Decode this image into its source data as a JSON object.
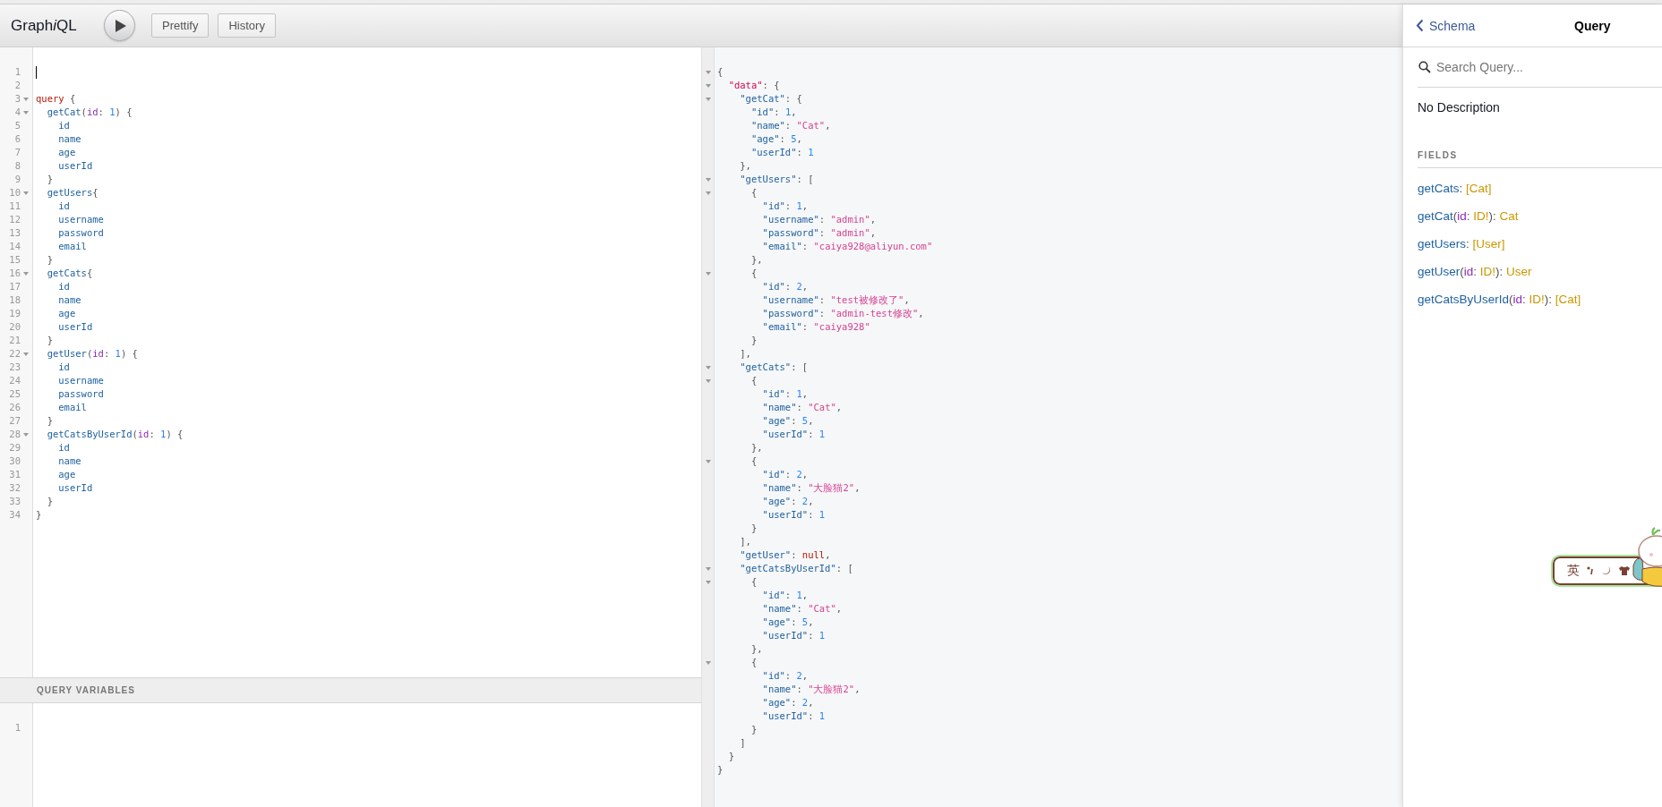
{
  "toolbar": {
    "title": [
      {
        "text": "Graph",
        "italic": false
      },
      {
        "text": "i",
        "italic": true
      },
      {
        "text": "QL",
        "italic": false
      }
    ],
    "buttons": [
      "Prettify",
      "History"
    ]
  },
  "query_editor": {
    "lines": [
      {
        "number": "1",
        "fold": false,
        "cursor": true
      },
      {
        "number": "2",
        "fold": false,
        "cursor": false
      },
      {
        "number": "3",
        "fold": true,
        "cursor": false,
        "tokens": [
          {
            "kind": "keyword",
            "text": "query"
          },
          {
            "kind": "punct",
            "text": " {"
          }
        ]
      },
      {
        "number": "4",
        "fold": true,
        "cursor": false,
        "tokens": [
          {
            "kind": "def",
            "text": "  getCat"
          },
          {
            "kind": "punct",
            "text": "("
          },
          {
            "kind": "attr",
            "text": "id"
          },
          {
            "kind": "punct",
            "text": ": "
          },
          {
            "kind": "number",
            "text": "1"
          },
          {
            "kind": "punct",
            "text": ") {"
          }
        ]
      },
      {
        "number": "5",
        "fold": false,
        "cursor": false,
        "tokens": [
          {
            "kind": "def",
            "text": "    id"
          }
        ]
      },
      {
        "number": "6",
        "fold": false,
        "cursor": false,
        "tokens": [
          {
            "kind": "def",
            "text": "    name"
          }
        ]
      },
      {
        "number": "7",
        "fold": false,
        "cursor": false,
        "tokens": [
          {
            "kind": "def",
            "text": "    age"
          }
        ]
      },
      {
        "number": "8",
        "fold": false,
        "cursor": false,
        "tokens": [
          {
            "kind": "def",
            "text": "    userId"
          }
        ]
      },
      {
        "number": "9",
        "fold": false,
        "cursor": false,
        "tokens": [
          {
            "kind": "punct",
            "text": "  }"
          }
        ]
      },
      {
        "number": "10",
        "fold": true,
        "cursor": false,
        "tokens": [
          {
            "kind": "def",
            "text": "  getUsers"
          },
          {
            "kind": "punct",
            "text": "{"
          }
        ]
      },
      {
        "number": "11",
        "fold": false,
        "cursor": false,
        "tokens": [
          {
            "kind": "def",
            "text": "    id"
          }
        ]
      },
      {
        "number": "12",
        "fold": false,
        "cursor": false,
        "tokens": [
          {
            "kind": "def",
            "text": "    username"
          }
        ]
      },
      {
        "number": "13",
        "fold": false,
        "cursor": false,
        "tokens": [
          {
            "kind": "def",
            "text": "    password"
          }
        ]
      },
      {
        "number": "14",
        "fold": false,
        "cursor": false,
        "tokens": [
          {
            "kind": "def",
            "text": "    email"
          }
        ]
      },
      {
        "number": "15",
        "fold": false,
        "cursor": false,
        "tokens": [
          {
            "kind": "punct",
            "text": "  }"
          }
        ]
      },
      {
        "number": "16",
        "fold": true,
        "cursor": false,
        "tokens": [
          {
            "kind": "def",
            "text": "  getCats"
          },
          {
            "kind": "punct",
            "text": "{"
          }
        ]
      },
      {
        "number": "17",
        "fold": false,
        "cursor": false,
        "tokens": [
          {
            "kind": "def",
            "text": "    id"
          }
        ]
      },
      {
        "number": "18",
        "fold": false,
        "cursor": false,
        "tokens": [
          {
            "kind": "def",
            "text": "    name"
          }
        ]
      },
      {
        "number": "19",
        "fold": false,
        "cursor": false,
        "tokens": [
          {
            "kind": "def",
            "text": "    age"
          }
        ]
      },
      {
        "number": "20",
        "fold": false,
        "cursor": false,
        "tokens": [
          {
            "kind": "def",
            "text": "    userId"
          }
        ]
      },
      {
        "number": "21",
        "fold": false,
        "cursor": false,
        "tokens": [
          {
            "kind": "punct",
            "text": "  }"
          }
        ]
      },
      {
        "number": "22",
        "fold": true,
        "cursor": false,
        "tokens": [
          {
            "kind": "def",
            "text": "  getUser"
          },
          {
            "kind": "punct",
            "text": "("
          },
          {
            "kind": "attr",
            "text": "id"
          },
          {
            "kind": "punct",
            "text": ": "
          },
          {
            "kind": "number",
            "text": "1"
          },
          {
            "kind": "punct",
            "text": ") {"
          }
        ]
      },
      {
        "number": "23",
        "fold": false,
        "cursor": false,
        "tokens": [
          {
            "kind": "def",
            "text": "    id"
          }
        ]
      },
      {
        "number": "24",
        "fold": false,
        "cursor": false,
        "tokens": [
          {
            "kind": "def",
            "text": "    username"
          }
        ]
      },
      {
        "number": "25",
        "fold": false,
        "cursor": false,
        "tokens": [
          {
            "kind": "def",
            "text": "    password"
          }
        ]
      },
      {
        "number": "26",
        "fold": false,
        "cursor": false,
        "tokens": [
          {
            "kind": "def",
            "text": "    email"
          }
        ]
      },
      {
        "number": "27",
        "fold": false,
        "cursor": false,
        "tokens": [
          {
            "kind": "punct",
            "text": "  }"
          }
        ]
      },
      {
        "number": "28",
        "fold": true,
        "cursor": false,
        "tokens": [
          {
            "kind": "def",
            "text": "  getCatsByUserId"
          },
          {
            "kind": "punct",
            "text": "("
          },
          {
            "kind": "attr",
            "text": "id"
          },
          {
            "kind": "punct",
            "text": ": "
          },
          {
            "kind": "number",
            "text": "1"
          },
          {
            "kind": "punct",
            "text": ") {"
          }
        ]
      },
      {
        "number": "29",
        "fold": false,
        "cursor": false,
        "tokens": [
          {
            "kind": "def",
            "text": "    id"
          }
        ]
      },
      {
        "number": "30",
        "fold": false,
        "cursor": false,
        "tokens": [
          {
            "kind": "def",
            "text": "    name"
          }
        ]
      },
      {
        "number": "31",
        "fold": false,
        "cursor": false,
        "tokens": [
          {
            "kind": "def",
            "text": "    age"
          }
        ]
      },
      {
        "number": "32",
        "fold": false,
        "cursor": false,
        "tokens": [
          {
            "kind": "def",
            "text": "    userId"
          }
        ]
      },
      {
        "number": "33",
        "fold": false,
        "cursor": false,
        "tokens": [
          {
            "kind": "punct",
            "text": "  }"
          }
        ]
      },
      {
        "number": "34",
        "fold": false,
        "cursor": false,
        "tokens": [
          {
            "kind": "punct",
            "text": "}"
          }
        ]
      }
    ]
  },
  "variables": {
    "title": "QUERY VARIABLES",
    "lines": [
      {
        "number": "1"
      }
    ]
  },
  "result": {
    "lines": [
      {
        "fold": true,
        "tokens": [
          {
            "kind": "punct",
            "text": "{"
          }
        ]
      },
      {
        "fold": true,
        "tokens": [
          {
            "kind": "datakey",
            "text": "  \"data\""
          },
          {
            "kind": "punct",
            "text": ": {"
          }
        ]
      },
      {
        "fold": true,
        "tokens": [
          {
            "kind": "key",
            "text": "    \"getCat\""
          },
          {
            "kind": "punct",
            "text": ": {"
          }
        ]
      },
      {
        "fold": false,
        "tokens": [
          {
            "kind": "key",
            "text": "      \"id\""
          },
          {
            "kind": "punct",
            "text": ": "
          },
          {
            "kind": "number",
            "text": "1"
          },
          {
            "kind": "punct",
            "text": ","
          }
        ]
      },
      {
        "fold": false,
        "tokens": [
          {
            "kind": "key",
            "text": "      \"name\""
          },
          {
            "kind": "punct",
            "text": ": "
          },
          {
            "kind": "string",
            "text": "\"Cat\""
          },
          {
            "kind": "punct",
            "text": ","
          }
        ]
      },
      {
        "fold": false,
        "tokens": [
          {
            "kind": "key",
            "text": "      \"age\""
          },
          {
            "kind": "punct",
            "text": ": "
          },
          {
            "kind": "number",
            "text": "5"
          },
          {
            "kind": "punct",
            "text": ","
          }
        ]
      },
      {
        "fold": false,
        "tokens": [
          {
            "kind": "key",
            "text": "      \"userId\""
          },
          {
            "kind": "punct",
            "text": ": "
          },
          {
            "kind": "number",
            "text": "1"
          }
        ]
      },
      {
        "fold": false,
        "tokens": [
          {
            "kind": "punct",
            "text": "    },"
          }
        ]
      },
      {
        "fold": true,
        "tokens": [
          {
            "kind": "key",
            "text": "    \"getUsers\""
          },
          {
            "kind": "punct",
            "text": ": ["
          }
        ]
      },
      {
        "fold": true,
        "tokens": [
          {
            "kind": "punct",
            "text": "      {"
          }
        ]
      },
      {
        "fold": false,
        "tokens": [
          {
            "kind": "key",
            "text": "        \"id\""
          },
          {
            "kind": "punct",
            "text": ": "
          },
          {
            "kind": "number",
            "text": "1"
          },
          {
            "kind": "punct",
            "text": ","
          }
        ]
      },
      {
        "fold": false,
        "tokens": [
          {
            "kind": "key",
            "text": "        \"username\""
          },
          {
            "kind": "punct",
            "text": ": "
          },
          {
            "kind": "string",
            "text": "\"admin\""
          },
          {
            "kind": "punct",
            "text": ","
          }
        ]
      },
      {
        "fold": false,
        "tokens": [
          {
            "kind": "key",
            "text": "        \"password\""
          },
          {
            "kind": "punct",
            "text": ": "
          },
          {
            "kind": "string",
            "text": "\"admin\""
          },
          {
            "kind": "punct",
            "text": ","
          }
        ]
      },
      {
        "fold": false,
        "tokens": [
          {
            "kind": "key",
            "text": "        \"email\""
          },
          {
            "kind": "punct",
            "text": ": "
          },
          {
            "kind": "string",
            "text": "\"caiya928@aliyun.com\""
          }
        ]
      },
      {
        "fold": false,
        "tokens": [
          {
            "kind": "punct",
            "text": "      },"
          }
        ]
      },
      {
        "fold": true,
        "tokens": [
          {
            "kind": "punct",
            "text": "      {"
          }
        ]
      },
      {
        "fold": false,
        "tokens": [
          {
            "kind": "key",
            "text": "        \"id\""
          },
          {
            "kind": "punct",
            "text": ": "
          },
          {
            "kind": "number",
            "text": "2"
          },
          {
            "kind": "punct",
            "text": ","
          }
        ]
      },
      {
        "fold": false,
        "tokens": [
          {
            "kind": "key",
            "text": "        \"username\""
          },
          {
            "kind": "punct",
            "text": ": "
          },
          {
            "kind": "string",
            "text": "\"test被修改了\""
          },
          {
            "kind": "punct",
            "text": ","
          }
        ]
      },
      {
        "fold": false,
        "tokens": [
          {
            "kind": "key",
            "text": "        \"password\""
          },
          {
            "kind": "punct",
            "text": ": "
          },
          {
            "kind": "string",
            "text": "\"admin-test修改\""
          },
          {
            "kind": "punct",
            "text": ","
          }
        ]
      },
      {
        "fold": false,
        "tokens": [
          {
            "kind": "key",
            "text": "        \"email\""
          },
          {
            "kind": "punct",
            "text": ": "
          },
          {
            "kind": "string",
            "text": "\"caiya928\""
          }
        ]
      },
      {
        "fold": false,
        "tokens": [
          {
            "kind": "punct",
            "text": "      }"
          }
        ]
      },
      {
        "fold": false,
        "tokens": [
          {
            "kind": "punct",
            "text": "    ],"
          }
        ]
      },
      {
        "fold": true,
        "tokens": [
          {
            "kind": "key",
            "text": "    \"getCats\""
          },
          {
            "kind": "punct",
            "text": ": ["
          }
        ]
      },
      {
        "fold": true,
        "tokens": [
          {
            "kind": "punct",
            "text": "      {"
          }
        ]
      },
      {
        "fold": false,
        "tokens": [
          {
            "kind": "key",
            "text": "        \"id\""
          },
          {
            "kind": "punct",
            "text": ": "
          },
          {
            "kind": "number",
            "text": "1"
          },
          {
            "kind": "punct",
            "text": ","
          }
        ]
      },
      {
        "fold": false,
        "tokens": [
          {
            "kind": "key",
            "text": "        \"name\""
          },
          {
            "kind": "punct",
            "text": ": "
          },
          {
            "kind": "string",
            "text": "\"Cat\""
          },
          {
            "kind": "punct",
            "text": ","
          }
        ]
      },
      {
        "fold": false,
        "tokens": [
          {
            "kind": "key",
            "text": "        \"age\""
          },
          {
            "kind": "punct",
            "text": ": "
          },
          {
            "kind": "number",
            "text": "5"
          },
          {
            "kind": "punct",
            "text": ","
          }
        ]
      },
      {
        "fold": false,
        "tokens": [
          {
            "kind": "key",
            "text": "        \"userId\""
          },
          {
            "kind": "punct",
            "text": ": "
          },
          {
            "kind": "number",
            "text": "1"
          }
        ]
      },
      {
        "fold": false,
        "tokens": [
          {
            "kind": "punct",
            "text": "      },"
          }
        ]
      },
      {
        "fold": true,
        "tokens": [
          {
            "kind": "punct",
            "text": "      {"
          }
        ]
      },
      {
        "fold": false,
        "tokens": [
          {
            "kind": "key",
            "text": "        \"id\""
          },
          {
            "kind": "punct",
            "text": ": "
          },
          {
            "kind": "number",
            "text": "2"
          },
          {
            "kind": "punct",
            "text": ","
          }
        ]
      },
      {
        "fold": false,
        "tokens": [
          {
            "kind": "key",
            "text": "        \"name\""
          },
          {
            "kind": "punct",
            "text": ": "
          },
          {
            "kind": "string",
            "text": "\"大脸猫2\""
          },
          {
            "kind": "punct",
            "text": ","
          }
        ]
      },
      {
        "fold": false,
        "tokens": [
          {
            "kind": "key",
            "text": "        \"age\""
          },
          {
            "kind": "punct",
            "text": ": "
          },
          {
            "kind": "number",
            "text": "2"
          },
          {
            "kind": "punct",
            "text": ","
          }
        ]
      },
      {
        "fold": false,
        "tokens": [
          {
            "kind": "key",
            "text": "        \"userId\""
          },
          {
            "kind": "punct",
            "text": ": "
          },
          {
            "kind": "number",
            "text": "1"
          }
        ]
      },
      {
        "fold": false,
        "tokens": [
          {
            "kind": "punct",
            "text": "      }"
          }
        ]
      },
      {
        "fold": false,
        "tokens": [
          {
            "kind": "punct",
            "text": "    ],"
          }
        ]
      },
      {
        "fold": false,
        "tokens": [
          {
            "kind": "key",
            "text": "    \"getUser\""
          },
          {
            "kind": "punct",
            "text": ": "
          },
          {
            "kind": "null",
            "text": "null"
          },
          {
            "kind": "punct",
            "text": ","
          }
        ]
      },
      {
        "fold": true,
        "tokens": [
          {
            "kind": "key",
            "text": "    \"getCatsByUserId\""
          },
          {
            "kind": "punct",
            "text": ": ["
          }
        ]
      },
      {
        "fold": true,
        "tokens": [
          {
            "kind": "punct",
            "text": "      {"
          }
        ]
      },
      {
        "fold": false,
        "tokens": [
          {
            "kind": "key",
            "text": "        \"id\""
          },
          {
            "kind": "punct",
            "text": ": "
          },
          {
            "kind": "number",
            "text": "1"
          },
          {
            "kind": "punct",
            "text": ","
          }
        ]
      },
      {
        "fold": false,
        "tokens": [
          {
            "kind": "key",
            "text": "        \"name\""
          },
          {
            "kind": "punct",
            "text": ": "
          },
          {
            "kind": "string",
            "text": "\"Cat\""
          },
          {
            "kind": "punct",
            "text": ","
          }
        ]
      },
      {
        "fold": false,
        "tokens": [
          {
            "kind": "key",
            "text": "        \"age\""
          },
          {
            "kind": "punct",
            "text": ": "
          },
          {
            "kind": "number",
            "text": "5"
          },
          {
            "kind": "punct",
            "text": ","
          }
        ]
      },
      {
        "fold": false,
        "tokens": [
          {
            "kind": "key",
            "text": "        \"userId\""
          },
          {
            "kind": "punct",
            "text": ": "
          },
          {
            "kind": "number",
            "text": "1"
          }
        ]
      },
      {
        "fold": false,
        "tokens": [
          {
            "kind": "punct",
            "text": "      },"
          }
        ]
      },
      {
        "fold": true,
        "tokens": [
          {
            "kind": "punct",
            "text": "      {"
          }
        ]
      },
      {
        "fold": false,
        "tokens": [
          {
            "kind": "key",
            "text": "        \"id\""
          },
          {
            "kind": "punct",
            "text": ": "
          },
          {
            "kind": "number",
            "text": "2"
          },
          {
            "kind": "punct",
            "text": ","
          }
        ]
      },
      {
        "fold": false,
        "tokens": [
          {
            "kind": "key",
            "text": "        \"name\""
          },
          {
            "kind": "punct",
            "text": ": "
          },
          {
            "kind": "string",
            "text": "\"大脸猫2\""
          },
          {
            "kind": "punct",
            "text": ","
          }
        ]
      },
      {
        "fold": false,
        "tokens": [
          {
            "kind": "key",
            "text": "        \"age\""
          },
          {
            "kind": "punct",
            "text": ": "
          },
          {
            "kind": "number",
            "text": "2"
          },
          {
            "kind": "punct",
            "text": ","
          }
        ]
      },
      {
        "fold": false,
        "tokens": [
          {
            "kind": "key",
            "text": "        \"userId\""
          },
          {
            "kind": "punct",
            "text": ": "
          },
          {
            "kind": "number",
            "text": "1"
          }
        ]
      },
      {
        "fold": false,
        "tokens": [
          {
            "kind": "punct",
            "text": "      }"
          }
        ]
      },
      {
        "fold": false,
        "tokens": [
          {
            "kind": "punct",
            "text": "    ]"
          }
        ]
      },
      {
        "fold": false,
        "tokens": [
          {
            "kind": "punct",
            "text": "  }"
          }
        ]
      },
      {
        "fold": false,
        "tokens": [
          {
            "kind": "punct",
            "text": "}"
          }
        ]
      }
    ]
  },
  "doc_explorer": {
    "back_label": "Schema",
    "title": "Query",
    "search": {
      "placeholder": "Search Query..."
    },
    "description": "No Description",
    "section_title": "FIELDS",
    "fields": [
      {
        "tokens": [
          {
            "kind": "name",
            "text": "getCats"
          },
          {
            "kind": "punct",
            "text": ": "
          },
          {
            "kind": "type",
            "text": "[Cat]"
          }
        ]
      },
      {
        "tokens": [
          {
            "kind": "name",
            "text": "getCat"
          },
          {
            "kind": "punct",
            "text": "("
          },
          {
            "kind": "arg",
            "text": "id"
          },
          {
            "kind": "punct",
            "text": ": "
          },
          {
            "kind": "type",
            "text": "ID!"
          },
          {
            "kind": "punct",
            "text": "): "
          },
          {
            "kind": "type",
            "text": "Cat"
          }
        ]
      },
      {
        "tokens": [
          {
            "kind": "name",
            "text": "getUsers"
          },
          {
            "kind": "punct",
            "text": ": "
          },
          {
            "kind": "type",
            "text": "[User]"
          }
        ]
      },
      {
        "tokens": [
          {
            "kind": "name",
            "text": "getUser"
          },
          {
            "kind": "punct",
            "text": "("
          },
          {
            "kind": "arg",
            "text": "id"
          },
          {
            "kind": "punct",
            "text": ": "
          },
          {
            "kind": "type",
            "text": "ID!"
          },
          {
            "kind": "punct",
            "text": "): "
          },
          {
            "kind": "type",
            "text": "User"
          }
        ]
      },
      {
        "tokens": [
          {
            "kind": "name",
            "text": "getCatsByUserId"
          },
          {
            "kind": "punct",
            "text": "("
          },
          {
            "kind": "arg",
            "text": "id"
          },
          {
            "kind": "punct",
            "text": ": "
          },
          {
            "kind": "type",
            "text": "ID!"
          },
          {
            "kind": "punct",
            "text": "): "
          },
          {
            "kind": "type",
            "text": "[Cat]"
          }
        ]
      }
    ]
  },
  "ime_toolbar": {
    "mode": "英"
  }
}
